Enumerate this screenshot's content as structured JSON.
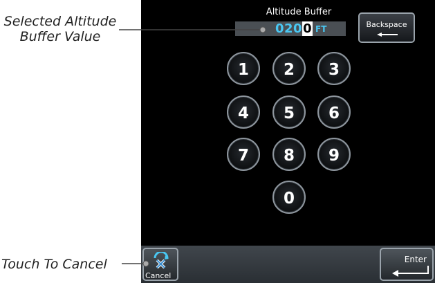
{
  "callouts": {
    "altitude_line1": "Selected Altitude",
    "altitude_line2": "Buffer Value",
    "cancel": "Touch To Cancel"
  },
  "header": {
    "title": "Altitude Buffer"
  },
  "field": {
    "value_before": "020",
    "value_cursor": "0",
    "unit": "FT"
  },
  "buttons": {
    "backspace": "Backspace",
    "cancel": "Cancel",
    "enter": "Enter"
  },
  "keypad": {
    "k1": "1",
    "k2": "2",
    "k3": "3",
    "k4": "4",
    "k5": "5",
    "k6": "6",
    "k7": "7",
    "k8": "8",
    "k9": "9",
    "k0": "0"
  },
  "colors": {
    "accent": "#49c7f2",
    "screen_bg": "#000000"
  }
}
